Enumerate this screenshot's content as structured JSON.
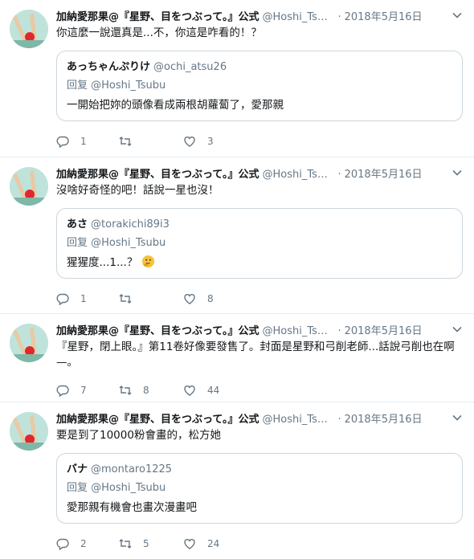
{
  "tweets": [
    {
      "name": "加納愛那果@『星野、目をつぶって。』公式",
      "handle": "@Hoshi_Tsubu",
      "sep": "·",
      "date": "2018年5月16日",
      "text": "你這麼一說還真是...不，你這是咋看的！？",
      "quote": {
        "name": "あっちゃんぷりけ",
        "handle": "@ochi_atsu26",
        "reply_to": "回复 @Hoshi_Tsubu",
        "text": "一開始把妳的頭像看成兩根胡蘿蔔了，愛那親"
      },
      "replies": "1",
      "retweets": "",
      "likes": "3"
    },
    {
      "name": "加納愛那果@『星野、目をつぶって。』公式",
      "handle": "@Hoshi_Tsubu",
      "sep": "·",
      "date": "2018年5月16日",
      "text": "沒啥好奇怪的吧！話說一星也沒！",
      "quote": {
        "name": "あさ",
        "handle": "@torakichi89i3",
        "reply_to": "回复 @Hoshi_Tsubu",
        "text": "猩猩度...1...？"
      },
      "replies": "1",
      "retweets": "",
      "likes": "8"
    },
    {
      "name": "加納愛那果@『星野、目をつぶって。』公式",
      "handle": "@Hoshi_Tsubu",
      "sep": "·",
      "date": "2018年5月16日",
      "text": "『星野，閉上眼。』第11卷好像要發售了。封面是星野和弓削老師...話說弓削也在啊—。",
      "quote": null,
      "replies": "7",
      "retweets": "8",
      "likes": "44"
    },
    {
      "name": "加納愛那果@『星野、目をつぶって。』公式",
      "handle": "@Hoshi_Tsubu",
      "sep": "·",
      "date": "2018年5月16日",
      "text": "要是到了10000粉會畫的，松方她",
      "quote": {
        "name": "バナ",
        "handle": "@montaro1225",
        "reply_to": "回复 @Hoshi_Tsubu",
        "text": "愛那親有機會也畫次漫畫吧"
      },
      "replies": "2",
      "retweets": "5",
      "likes": "24"
    }
  ],
  "colors": {
    "text": "#14171a",
    "muted": "#657786",
    "border": "#e6ecf0",
    "quote_border": "#ccd6dd"
  }
}
